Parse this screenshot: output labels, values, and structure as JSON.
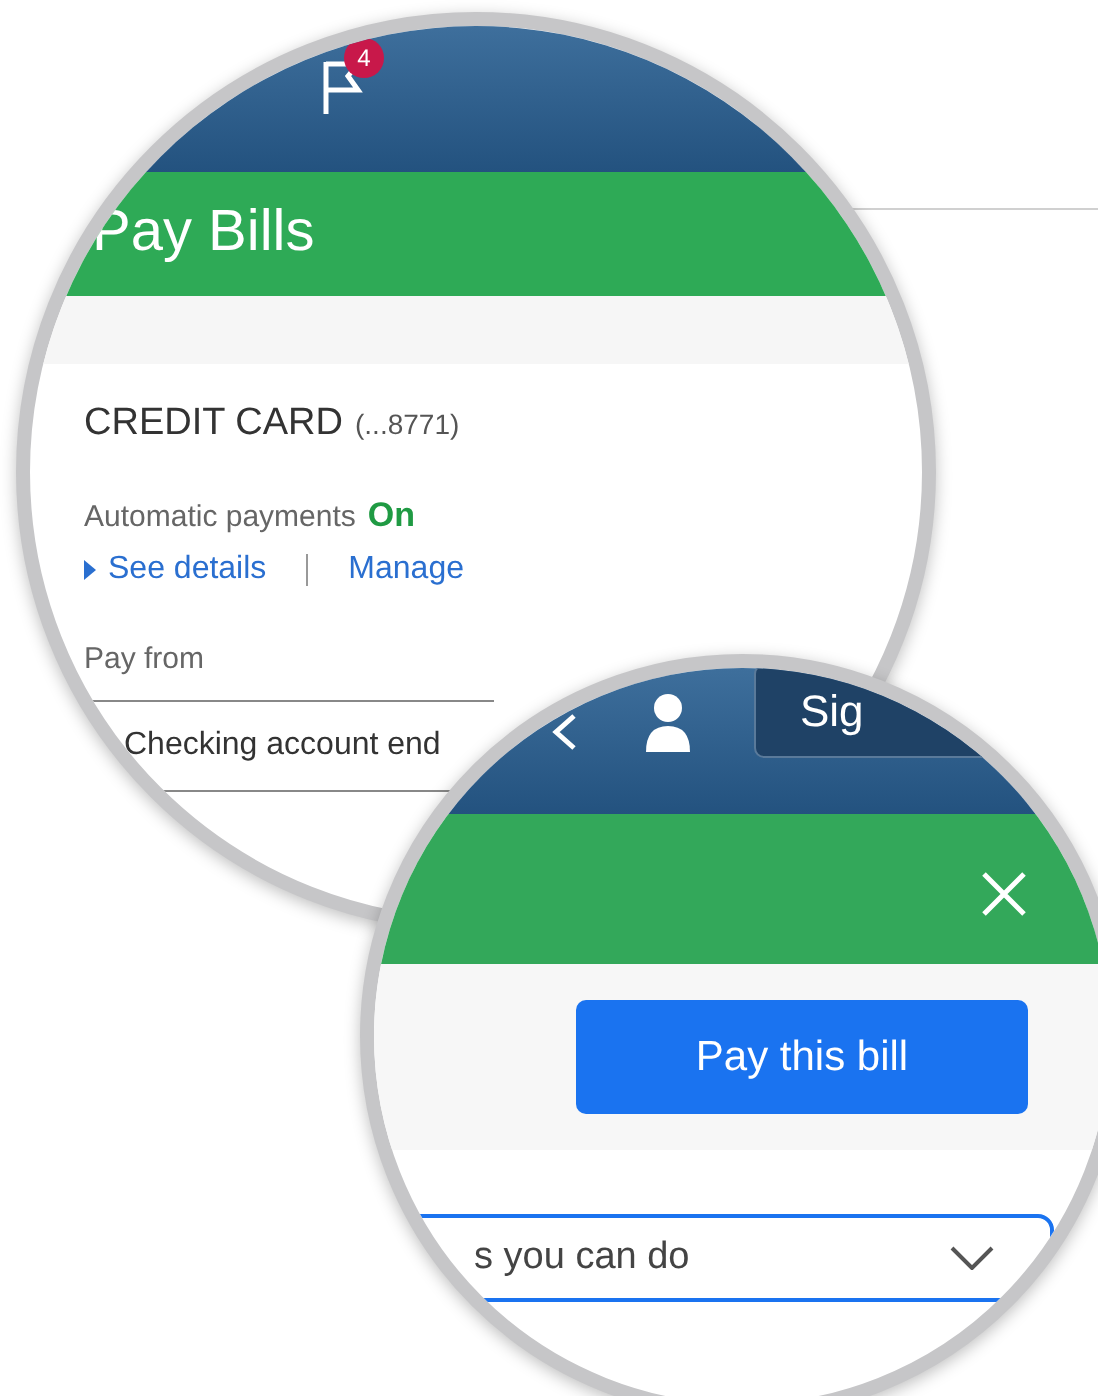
{
  "notifications": {
    "badge": "4"
  },
  "title": "Pay Bills",
  "account": {
    "name": "CREDIT CARD",
    "number": "(...8771)"
  },
  "autopay": {
    "label": "Automatic payments",
    "status": "On",
    "on": true
  },
  "links": [
    {
      "label": "See details",
      "kind": "expander"
    },
    {
      "label": "Manage",
      "kind": "link"
    }
  ],
  "pay_from": {
    "label": "Pay from",
    "value": "Checking account end"
  },
  "zoom_header": {
    "sign_in": "Sig"
  },
  "pay_button": "Pay this bill",
  "actions_dropdown": {
    "value": "s you can do"
  }
}
